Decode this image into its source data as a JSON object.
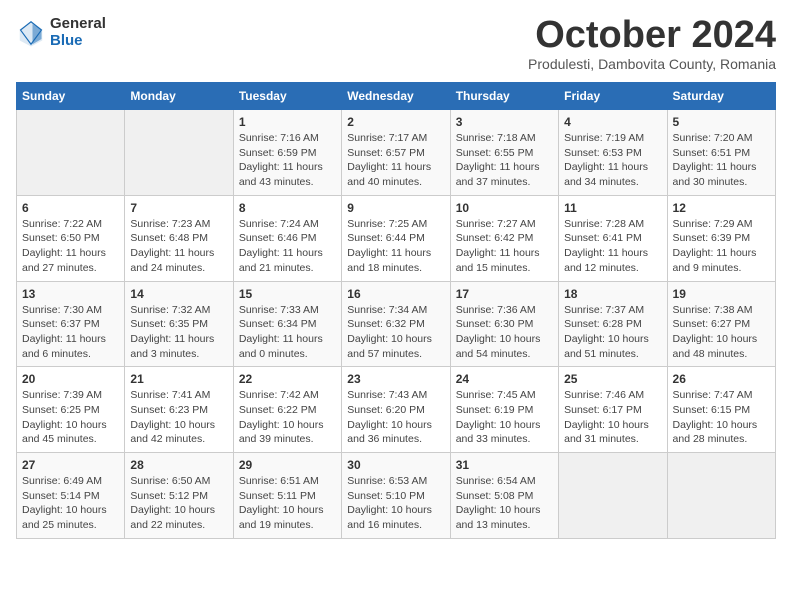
{
  "header": {
    "logo_general": "General",
    "logo_blue": "Blue",
    "month_title": "October 2024",
    "subtitle": "Produlesti, Dambovita County, Romania"
  },
  "days_of_week": [
    "Sunday",
    "Monday",
    "Tuesday",
    "Wednesday",
    "Thursday",
    "Friday",
    "Saturday"
  ],
  "weeks": [
    [
      {
        "day": "",
        "info": ""
      },
      {
        "day": "",
        "info": ""
      },
      {
        "day": "1",
        "info": "Sunrise: 7:16 AM\nSunset: 6:59 PM\nDaylight: 11 hours and 43 minutes."
      },
      {
        "day": "2",
        "info": "Sunrise: 7:17 AM\nSunset: 6:57 PM\nDaylight: 11 hours and 40 minutes."
      },
      {
        "day": "3",
        "info": "Sunrise: 7:18 AM\nSunset: 6:55 PM\nDaylight: 11 hours and 37 minutes."
      },
      {
        "day": "4",
        "info": "Sunrise: 7:19 AM\nSunset: 6:53 PM\nDaylight: 11 hours and 34 minutes."
      },
      {
        "day": "5",
        "info": "Sunrise: 7:20 AM\nSunset: 6:51 PM\nDaylight: 11 hours and 30 minutes."
      }
    ],
    [
      {
        "day": "6",
        "info": "Sunrise: 7:22 AM\nSunset: 6:50 PM\nDaylight: 11 hours and 27 minutes."
      },
      {
        "day": "7",
        "info": "Sunrise: 7:23 AM\nSunset: 6:48 PM\nDaylight: 11 hours and 24 minutes."
      },
      {
        "day": "8",
        "info": "Sunrise: 7:24 AM\nSunset: 6:46 PM\nDaylight: 11 hours and 21 minutes."
      },
      {
        "day": "9",
        "info": "Sunrise: 7:25 AM\nSunset: 6:44 PM\nDaylight: 11 hours and 18 minutes."
      },
      {
        "day": "10",
        "info": "Sunrise: 7:27 AM\nSunset: 6:42 PM\nDaylight: 11 hours and 15 minutes."
      },
      {
        "day": "11",
        "info": "Sunrise: 7:28 AM\nSunset: 6:41 PM\nDaylight: 11 hours and 12 minutes."
      },
      {
        "day": "12",
        "info": "Sunrise: 7:29 AM\nSunset: 6:39 PM\nDaylight: 11 hours and 9 minutes."
      }
    ],
    [
      {
        "day": "13",
        "info": "Sunrise: 7:30 AM\nSunset: 6:37 PM\nDaylight: 11 hours and 6 minutes."
      },
      {
        "day": "14",
        "info": "Sunrise: 7:32 AM\nSunset: 6:35 PM\nDaylight: 11 hours and 3 minutes."
      },
      {
        "day": "15",
        "info": "Sunrise: 7:33 AM\nSunset: 6:34 PM\nDaylight: 11 hours and 0 minutes."
      },
      {
        "day": "16",
        "info": "Sunrise: 7:34 AM\nSunset: 6:32 PM\nDaylight: 10 hours and 57 minutes."
      },
      {
        "day": "17",
        "info": "Sunrise: 7:36 AM\nSunset: 6:30 PM\nDaylight: 10 hours and 54 minutes."
      },
      {
        "day": "18",
        "info": "Sunrise: 7:37 AM\nSunset: 6:28 PM\nDaylight: 10 hours and 51 minutes."
      },
      {
        "day": "19",
        "info": "Sunrise: 7:38 AM\nSunset: 6:27 PM\nDaylight: 10 hours and 48 minutes."
      }
    ],
    [
      {
        "day": "20",
        "info": "Sunrise: 7:39 AM\nSunset: 6:25 PM\nDaylight: 10 hours and 45 minutes."
      },
      {
        "day": "21",
        "info": "Sunrise: 7:41 AM\nSunset: 6:23 PM\nDaylight: 10 hours and 42 minutes."
      },
      {
        "day": "22",
        "info": "Sunrise: 7:42 AM\nSunset: 6:22 PM\nDaylight: 10 hours and 39 minutes."
      },
      {
        "day": "23",
        "info": "Sunrise: 7:43 AM\nSunset: 6:20 PM\nDaylight: 10 hours and 36 minutes."
      },
      {
        "day": "24",
        "info": "Sunrise: 7:45 AM\nSunset: 6:19 PM\nDaylight: 10 hours and 33 minutes."
      },
      {
        "day": "25",
        "info": "Sunrise: 7:46 AM\nSunset: 6:17 PM\nDaylight: 10 hours and 31 minutes."
      },
      {
        "day": "26",
        "info": "Sunrise: 7:47 AM\nSunset: 6:15 PM\nDaylight: 10 hours and 28 minutes."
      }
    ],
    [
      {
        "day": "27",
        "info": "Sunrise: 6:49 AM\nSunset: 5:14 PM\nDaylight: 10 hours and 25 minutes."
      },
      {
        "day": "28",
        "info": "Sunrise: 6:50 AM\nSunset: 5:12 PM\nDaylight: 10 hours and 22 minutes."
      },
      {
        "day": "29",
        "info": "Sunrise: 6:51 AM\nSunset: 5:11 PM\nDaylight: 10 hours and 19 minutes."
      },
      {
        "day": "30",
        "info": "Sunrise: 6:53 AM\nSunset: 5:10 PM\nDaylight: 10 hours and 16 minutes."
      },
      {
        "day": "31",
        "info": "Sunrise: 6:54 AM\nSunset: 5:08 PM\nDaylight: 10 hours and 13 minutes."
      },
      {
        "day": "",
        "info": ""
      },
      {
        "day": "",
        "info": ""
      }
    ]
  ]
}
